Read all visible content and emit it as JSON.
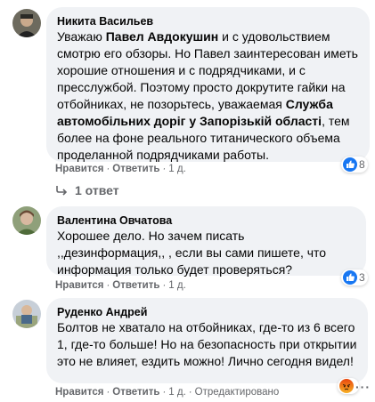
{
  "comments": [
    {
      "author": "Никита Васильев",
      "text_parts": {
        "p1": "Уважаю ",
        "p2": "Павел Авдокушин",
        "p3": " и с удовольствием смотрю его обзоры. Но Павел заинтересован иметь хорошие отношения и с подрядчиками, и с пресслужбой. Поэтому просто докрутите гайки на отбойниках, не позорьтесь, уважаемая ",
        "p4": "Служба автомобільних доріг у Запорізькій області",
        "p5": ", тем более на фоне реального титанического объема проделанной подрядчиками работы."
      },
      "like_label": "Нравится",
      "reply_label": "Ответить",
      "time": "1 д.",
      "reaction_count": "8",
      "reaction_icon": "like-icon",
      "replies_label": "1 ответ"
    },
    {
      "author": "Валентина Овчатова",
      "text": "Хорошее дело. Но зачем писать ,,дезинформация,, , если вы сами пишете, что информация только будет проверяться?",
      "like_label": "Нравится",
      "reply_label": "Ответить",
      "time": "1 д.",
      "reaction_count": "3",
      "reaction_icon": "like-icon"
    },
    {
      "author": "Руденко Андрей",
      "text": "Болтов не хватало на отбойниках, где-то из 6 всего 1, где-то больше! Но на безопасность при открытии это не влияет, ездить можно! Лично сегодня видел!",
      "like_label": "Нравится",
      "reply_label": "Ответить",
      "time": "1 д.",
      "edited_label": "Отредактировано",
      "reaction_icon": "angry-icon"
    }
  ],
  "colors": {
    "bubble": "#f0f2f5",
    "meta": "#65676b",
    "like_blue": "#1877f2",
    "angry_orange": "#e9710f"
  }
}
